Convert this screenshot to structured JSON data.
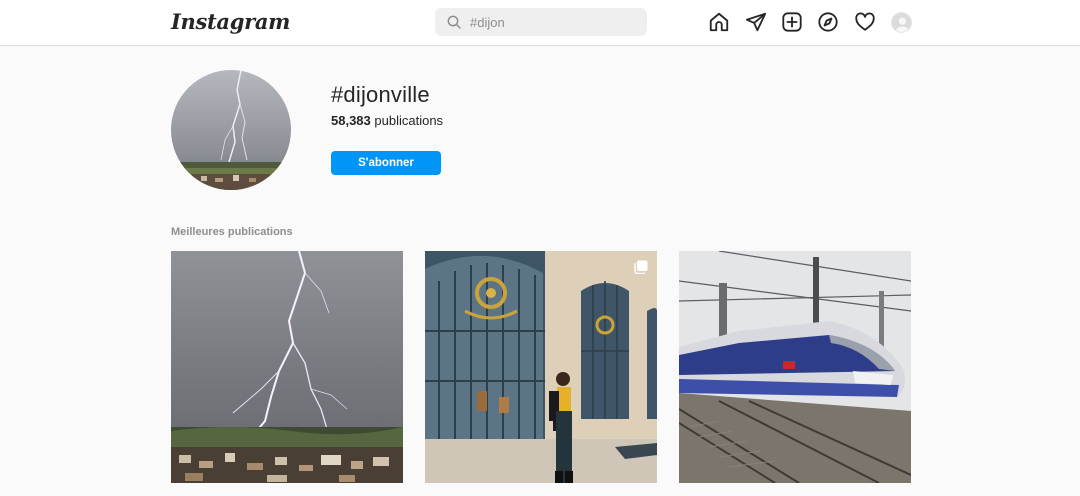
{
  "header": {
    "logo_text": "Instagram",
    "search": {
      "value": "#dijon"
    },
    "nav": [
      "home-icon",
      "direct-icon",
      "new-post-icon",
      "explore-icon",
      "activity-icon",
      "profile-avatar"
    ]
  },
  "profile": {
    "hashtag": "#dijonville",
    "publications_count": "58,383",
    "publications_label": "publications",
    "follow_label": "S'abonner"
  },
  "top_posts": {
    "title": "Meilleures publications",
    "posts": [
      {
        "subject": "lightning-over-town",
        "multi": false
      },
      {
        "subject": "woman-at-gilded-gates",
        "multi": true
      },
      {
        "subject": "tgv-train",
        "multi": false
      }
    ]
  },
  "colors": {
    "accent": "#0095f6",
    "text": "#262626",
    "muted": "#8e8e8e",
    "border": "#dbdbdb"
  }
}
